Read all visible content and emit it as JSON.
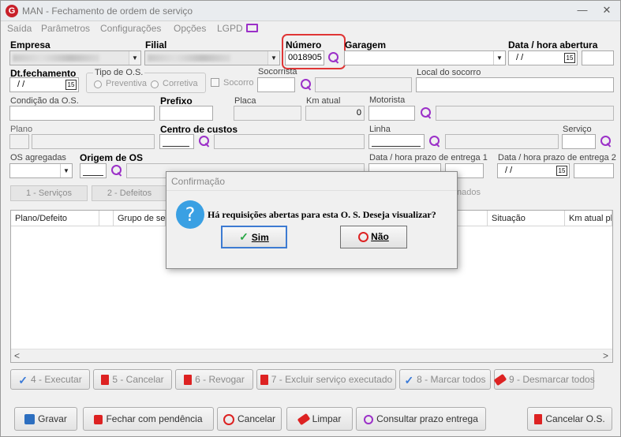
{
  "window": {
    "title": "MAN - Fechamento de ordem de serviço",
    "logo_letter": "G",
    "min": "—",
    "close": "✕"
  },
  "menu": [
    "Saída",
    "Parâmetros",
    "Configurações",
    "Opções",
    "LGPD"
  ],
  "form": {
    "empresa_label": "Empresa",
    "filial_label": "Filial",
    "numero_label": "Número",
    "numero_value": "0018905",
    "garagem_label": "Garagem",
    "data_abertura_label": "Data / hora abertura",
    "data_abertura_value": "/ /",
    "dt_fechamento_label": "Dt.fechamento",
    "dt_fechamento_value": "/ /",
    "tipo_os_label": "Tipo de O.S.",
    "preventiva": "Preventiva",
    "corretiva": "Corretiva",
    "socorro_check": "Socorro",
    "socorrista_label": "Socorrista",
    "local_socorro_label": "Local do socorro",
    "condicao_label": "Condição da O.S.",
    "prefixo_label": "Prefixo",
    "placa_label": "Placa",
    "km_atual_label": "Km atual",
    "km_atual_value": "0",
    "motorista_label": "Motorista",
    "plano_label": "Plano",
    "centro_custos_label": "Centro de custos",
    "linha_label": "Linha",
    "servico_label": "Serviço",
    "os_agregadas_label": "OS agregadas",
    "origem_os_label": "Origem de OS",
    "prazo1_label": "Data / hora prazo de entrega 1",
    "prazo2_label": "Data / hora prazo de entrega 2",
    "prazo2_value": "/ /",
    "calendar_glyph": "15"
  },
  "tabs": [
    "1 - Serviços",
    "2 - Defeitos",
    "nados"
  ],
  "grid": {
    "headers": [
      "Plano/Defeito",
      "Grupo de se",
      "Situação",
      "Km atual pl"
    ],
    "scroll_left": "<",
    "scroll_right": ">"
  },
  "actions": [
    {
      "label": "4 - Executar"
    },
    {
      "label": "5 - Cancelar"
    },
    {
      "label": "6 - Revogar"
    },
    {
      "label": "7 - Excluir serviço executado"
    },
    {
      "label": "8 - Marcar todos"
    },
    {
      "label": "9 - Desmarcar todos"
    }
  ],
  "footer": {
    "gravar": "Gravar",
    "fechar_pendencia": "Fechar com pendência",
    "cancelar": "Cancelar",
    "limpar": "Limpar",
    "consultar_prazo": "Consultar prazo entrega",
    "cancelar_os": "Cancelar O.S."
  },
  "dialog": {
    "title": "Confirmação",
    "message": "Há requisições abertas para esta O. S. Deseja visualizar?",
    "yes": "Sim",
    "no": "Não",
    "icon": "?"
  },
  "colors": {
    "highlight": "#e03535",
    "accent": "#3d7bd2",
    "search_icon": "#9b30c8"
  }
}
